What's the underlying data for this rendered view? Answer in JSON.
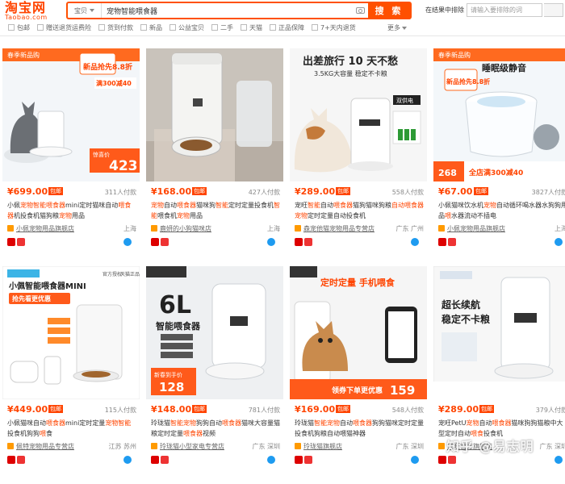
{
  "header": {
    "logo": "淘宝网",
    "logo_sub": "Taobao.com",
    "scope_label": "宝贝",
    "query": "宠物智能喂食器",
    "search_button": "搜 索",
    "within_label": "在结果中排除",
    "within_placeholder": "请输入要排除的词"
  },
  "filters": [
    "包邮",
    "赠送退货运费险",
    "货到付款",
    "新品",
    "公益宝贝",
    "二手",
    "天猫",
    "正品保障",
    "7+天内退货"
  ],
  "more_label": "更多",
  "products": [
    {
      "price": "¥699.00",
      "badge": "包邮",
      "sold": "311人付款",
      "title_parts": [
        [
          "小佩",
          "n"
        ],
        [
          "宠物智能喂食器",
          "h"
        ],
        [
          "mini定时猫咪自动",
          "n"
        ],
        [
          "喂食器",
          "h"
        ],
        [
          "机投食机猫狗粮",
          "n"
        ],
        [
          "宠物",
          "h"
        ],
        [
          "用品",
          "n"
        ]
      ],
      "shop": "小佩宠物用品旗舰店",
      "location": "上海",
      "image": {
        "top_label": "春季新品购",
        "promo1": "满300减40",
        "promo2": "惊喜价",
        "promo_price": "423",
        "deal": "新品抢先8.8折"
      }
    },
    {
      "price": "¥168.00",
      "badge": "包邮",
      "sold": "427人付款",
      "title_parts": [
        [
          "宠物",
          "h"
        ],
        [
          "自动",
          "n"
        ],
        [
          "喂食器",
          "h"
        ],
        [
          "猫咪狗",
          "n"
        ],
        [
          "智能",
          "h"
        ],
        [
          "定时定量投食机",
          "n"
        ],
        [
          "智能",
          "h"
        ],
        [
          "喂食机",
          "n"
        ],
        [
          "宠物",
          "h"
        ],
        [
          "用品",
          "n"
        ]
      ],
      "shop": "鹿妍的小狗猫咪店",
      "location": "上海",
      "image": {}
    },
    {
      "price": "¥289.00",
      "badge": "包邮",
      "sold": "558人付款",
      "title_parts": [
        [
          "宠旺",
          "n"
        ],
        [
          "智能",
          "h"
        ],
        [
          "自动",
          "n"
        ],
        [
          "喂食器",
          "h"
        ],
        [
          "猫狗猫咪狗粮",
          "n"
        ],
        [
          "自动喂食器",
          "h"
        ],
        [
          "宠物",
          "h"
        ],
        [
          "定时定量",
          "n"
        ],
        [
          "自动投食机",
          "n"
        ]
      ],
      "shop": "森宠他猫宠物用品专营店",
      "location": "广东 广州",
      "image": {
        "headline": "出差旅行 10 天不愁",
        "sub": "3.5KG大容量 稳定不卡粮",
        "tag": "双供电"
      }
    },
    {
      "price": "¥67.00",
      "badge": "包邮",
      "sold": "3827人付款",
      "title_parts": [
        [
          "小佩猫咪饮水机",
          "n"
        ],
        [
          "宠物",
          "h"
        ],
        [
          "自动循环喝水器",
          "n"
        ],
        [
          "水狗狗用品",
          "n"
        ],
        [
          "喂",
          "h"
        ],
        [
          "水器流动不插电",
          "n"
        ]
      ],
      "shop": "小佩宠物用品旗舰店",
      "location": "上海",
      "image": {
        "top_label": "春季新品购",
        "headline": "睡眠级静音",
        "promo1": "全店满300减40",
        "promo_price": "268",
        "deal": "新品抢先8.8折"
      }
    },
    {
      "price": "¥449.00",
      "badge": "包邮",
      "sold": "115人付款",
      "title_parts": [
        [
          "小佩猫咪自动",
          "n"
        ],
        [
          "喂食器",
          "h"
        ],
        [
          "mini定时定量",
          "n"
        ],
        [
          "宠物智能",
          "h"
        ],
        [
          "投食机",
          "n"
        ],
        [
          "狗狗",
          "n"
        ],
        [
          "喂",
          "h"
        ],
        [
          "食",
          "n"
        ]
      ],
      "shop": "佩特宠物用品专营店",
      "location": "江苏 苏州",
      "image": {
        "headline": "小佩智能喂食器MINI",
        "sub": "抢先看更优惠",
        "note1": "官方授权",
        "note2": "天猫正品"
      }
    },
    {
      "price": "¥148.00",
      "badge": "包邮",
      "sold": "781人付款",
      "title_parts": [
        [
          "玲珑猫",
          "n"
        ],
        [
          "智能宠物",
          "h"
        ],
        [
          "狗狗自动",
          "n"
        ],
        [
          "喂食器",
          "h"
        ],
        [
          "猫咪大容量",
          "n"
        ],
        [
          "猫粮定时定量",
          "n"
        ],
        [
          "喂食器",
          "h"
        ],
        [
          "视频",
          "n"
        ]
      ],
      "shop": "玲珑猫小型家电专营店",
      "location": "广东 深圳",
      "image": {
        "big": "6L",
        "headline": "智能喂食器",
        "promo_price": "128",
        "deal": "新春到手价"
      }
    },
    {
      "price": "¥169.00",
      "badge": "包邮",
      "sold": "548人付款",
      "title_parts": [
        [
          "玲珑猫",
          "n"
        ],
        [
          "智能宠物",
          "h"
        ],
        [
          "自动",
          "n"
        ],
        [
          "喂食器",
          "h"
        ],
        [
          "狗狗猫咪定时定量投",
          "n"
        ],
        [
          "食机狗粮自动喂猫神器",
          "n"
        ]
      ],
      "shop": "玲珑猫旗舰店",
      "location": "广东 深圳",
      "image": {
        "headline": "定时定量 手机喂食",
        "promo_price": "159",
        "deal": "领券下单更优惠"
      }
    },
    {
      "price": "¥289.00",
      "badge": "包邮",
      "sold": "379人付款",
      "title_parts": [
        [
          "宠旺PetU",
          "n"
        ],
        [
          "宠物",
          "h"
        ],
        [
          "自动",
          "n"
        ],
        [
          "喂食器",
          "h"
        ],
        [
          "猫咪狗狗猫粮中大型",
          "n"
        ],
        [
          "定时自动",
          "n"
        ],
        [
          "喂食",
          "h"
        ],
        [
          "投食机",
          "n"
        ]
      ],
      "shop": "宠旺官方旗舰店",
      "location": "广东 深圳",
      "image": {
        "headline": "超长续航",
        "sub": "稳定不卡粮",
        "footer": "宠旺官方旗舰店"
      }
    }
  ],
  "watermark": "知乎 @易志明",
  "colors": {
    "accent": "#ff4400",
    "orange": "#ff5000"
  }
}
